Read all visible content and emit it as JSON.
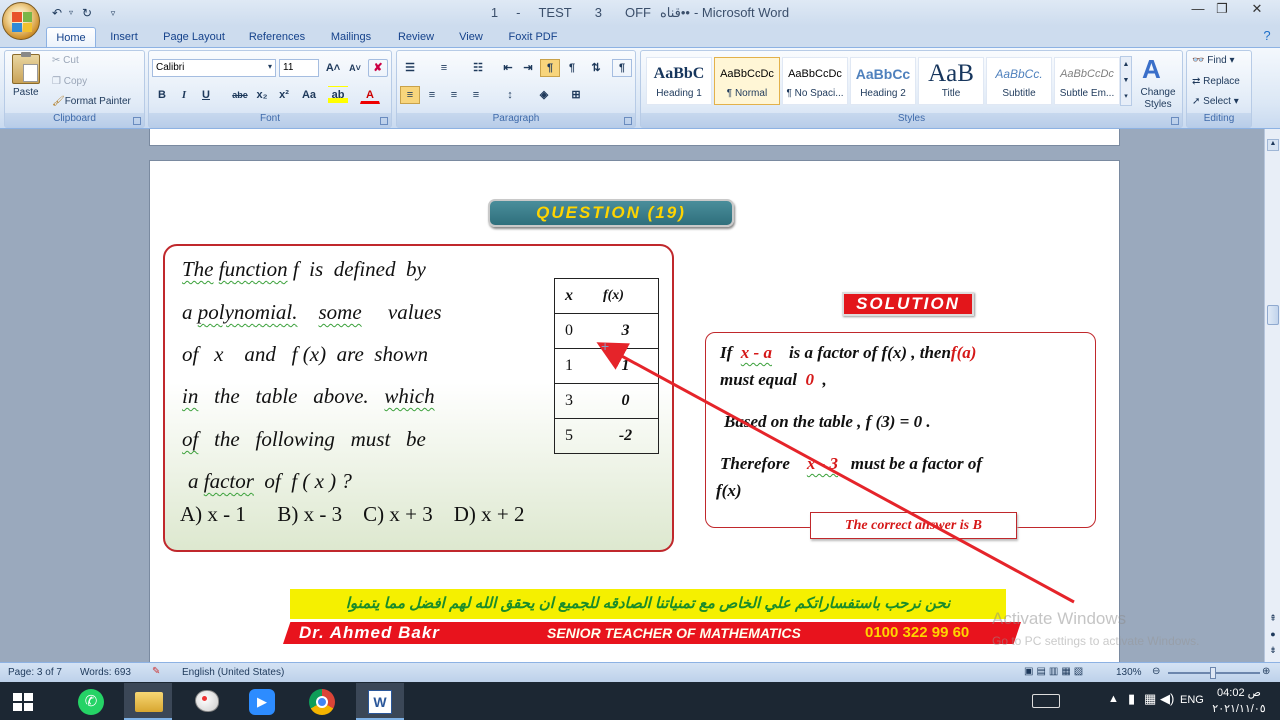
{
  "window": {
    "title_parts": [
      "1",
      "-",
      "TEST",
      "3",
      "OFF",
      "قناه••",
      "- Microsoft Word"
    ],
    "controls": {
      "minimize": "—",
      "restore": "❐",
      "close": "✕"
    }
  },
  "qat": {
    "undo": "↶",
    "redo": "↻",
    "customize": "▿"
  },
  "tabs": [
    "Home",
    "Insert",
    "Page Layout",
    "References",
    "Mailings",
    "Review",
    "View",
    "Foxit PDF"
  ],
  "ribbon": {
    "clipboard": {
      "label": "Clipboard",
      "paste": "Paste",
      "cut": "Cut",
      "copy": "Copy",
      "format_painter": "Format Painter"
    },
    "font": {
      "label": "Font",
      "name": "Calibri",
      "size": "11",
      "grow": "A˄",
      "shrink": "A˅",
      "clear": "✘",
      "bold": "B",
      "italic": "I",
      "underline": "U",
      "strike": "abe",
      "subscript": "x₂",
      "superscript": "x²",
      "case": "Aa",
      "highlight": "ab",
      "color": "A"
    },
    "paragraph": {
      "label": "Paragraph",
      "pilcrow": "¶"
    },
    "styles": {
      "label": "Styles",
      "change_styles": "Change Styles",
      "items": [
        {
          "sample": "AaBbC",
          "name": "Heading 1"
        },
        {
          "sample": "AaBbCcDc",
          "name": "¶ Normal"
        },
        {
          "sample": "AaBbCcDc",
          "name": "¶ No Spaci..."
        },
        {
          "sample": "AaBbCc",
          "name": "Heading 2"
        },
        {
          "sample": "AaB",
          "name": "Title"
        },
        {
          "sample": "AaBbCc.",
          "name": "Subtitle"
        },
        {
          "sample": "AaBbCcDc",
          "name": "Subtle Em..."
        }
      ]
    },
    "editing": {
      "label": "Editing",
      "find": "Find",
      "replace": "Replace",
      "select": "Select"
    }
  },
  "document": {
    "question_title": "QUESTION (19)",
    "question_lines": [
      [
        "The",
        "function",
        "f",
        "is",
        "defined",
        "by"
      ],
      [
        "a",
        "polynomial.",
        "some",
        "values"
      ],
      [
        "of",
        "x",
        "and",
        "f (x)",
        "are",
        "shown"
      ],
      [
        "in",
        "the",
        "table",
        "above.",
        "which"
      ],
      [
        "of",
        "the",
        "following",
        "must",
        "be"
      ],
      [
        "a",
        "factor",
        "of",
        "f ( x )",
        "?"
      ]
    ],
    "choices": [
      "A)  x - 1",
      "B) x - 3",
      "C) x + 3",
      "D) x + 2"
    ],
    "table": {
      "headers": [
        "x",
        "f(x)"
      ],
      "rows": [
        [
          "0",
          "3"
        ],
        [
          "1",
          "1"
        ],
        [
          "3",
          "0"
        ],
        [
          "5",
          "-2"
        ]
      ]
    },
    "solution_title": "SOLUTION",
    "solution": {
      "l1_if": "If",
      "l1_factor": "x  -  a",
      "l1_rest": "is  a  factor  of  f(x) ,  then",
      "l1_fa": "f(a)",
      "l2_a": "must  equal",
      "l2_zero": "0",
      "l2_b": ",",
      "l3": "Based  on  the  table ,   f (3)  =  0  .",
      "l4_a": "Therefore",
      "l4_factor": "x  -  3",
      "l4_b": "must  be  a  factor  of",
      "l5": "f(x)",
      "answer": "The  correct answer  is  B"
    },
    "arabic_banner": "نحن نرحب باستفساراتكم علي الخاص     مع تمنياتنا الصادقه للجميع     ان يحقق الله لهم افضل  مما يتمنوا",
    "teacher_banner": {
      "name": "Dr. Ahmed Bakr",
      "role": "SENIOR  TEACHER  OF  MATHEMATICS",
      "phone": "0100   322    99 60"
    },
    "watermark": {
      "line1": "Activate Windows",
      "line2": "Go to PC settings to activate Windows."
    }
  },
  "status": {
    "page": "Page: 3 of 7",
    "words": "Words: 693",
    "language": "English (United States)",
    "zoom": "130%"
  },
  "taskbar": {
    "lang": "ENG",
    "time": "04:02 ص",
    "date": "٢٠٢١/١١/٠٥"
  },
  "colors": {
    "accent": "#d51818",
    "banner_yellow": "#f5f000",
    "question_badge": "#2f6f7c",
    "badge_text": "#ffd400"
  }
}
